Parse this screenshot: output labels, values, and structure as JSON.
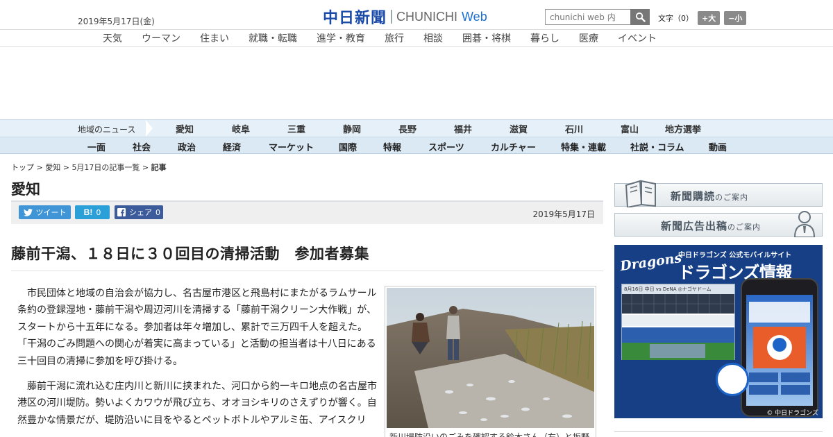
{
  "header": {
    "date": "2019年5月17日(金)",
    "logo_jp": "中日新聞",
    "logo_en": "CHUNICHI",
    "logo_web": "Web",
    "search_placeholder": "chunichi web 内",
    "font_size_label": "文字（0）",
    "font_larger": "+大",
    "font_smaller": "−小"
  },
  "nav1": [
    "天気",
    "ウーマン",
    "住まい",
    "就職・転職",
    "進学・教育",
    "旅行",
    "相談",
    "囲碁・将棋",
    "暮らし",
    "医療",
    "イベント"
  ],
  "region": {
    "label": "地域のニュース",
    "items": [
      "愛知",
      "岐阜",
      "三重",
      "静岡",
      "長野",
      "福井",
      "滋賀",
      "石川",
      "富山",
      "地方選挙"
    ]
  },
  "sections": [
    "一面",
    "社会",
    "政治",
    "経済",
    "マーケット",
    "国際",
    "特報",
    "スポーツ",
    "カルチャー",
    "特集・連載",
    "社説・コラム",
    "動画"
  ],
  "breadcrumb": {
    "top": "トップ",
    "region": "愛知",
    "list": "5月17日の記事一覧",
    "current": "記事",
    "sep": " > "
  },
  "page_title": "愛知",
  "share": {
    "tweet": "ツイート",
    "hatena_icon": "B!",
    "hatena_count": "0",
    "fb_label": "シェア",
    "fb_count": "0",
    "date": "2019年5月17日"
  },
  "article": {
    "headline": "藤前干潟、１８日に３０回目の清掃活動　参加者募集",
    "paragraphs": [
      "市民団体と地域の自治会が協力し、名古屋市港区と飛島村にまたがるラムサール条約の登録湿地・藤前干潟や周辺河川を清掃する「藤前干潟クリーン大作戦」が、スタートから十五年になる。参加者は年々増加し、累計で三万四千人を超えた。「干潟のごみ問題への関心が着実に高まっている」と活動の担当者は十八日にある三十回目の清掃に参加を呼び掛ける。",
      "藤前干潟に流れ込む庄内川と新川に挟まれた、河口から約一キロ地点の名古屋市港区の河川堤防。勢いよくカワウが飛び立ち、オオヨシキリのさえずりが響く。自然豊かな情景だが、堤防沿いに目をやるとペットボトルやアルミ缶、アイスクリ"
    ],
    "photo_caption": "新川堤防沿いのごみを確認する鈴木さん（右）と坂野"
  },
  "sidebar": {
    "subscribe_main": "新聞購読",
    "subscribe_sub": "のご案内",
    "ad_main": "新聞広告出稿",
    "ad_sub": "のご案内",
    "dragons_logo": "Dragons",
    "dragons_tag": "中日ドラゴンズ 公式モバイルサイト",
    "dragons_title": "ドラゴンズ情報",
    "dragons_score": "8月16日 中日 vs DeNA ◎ナゴヤドーム",
    "dragons_copyright": "© 中日ドラゴンズ"
  }
}
